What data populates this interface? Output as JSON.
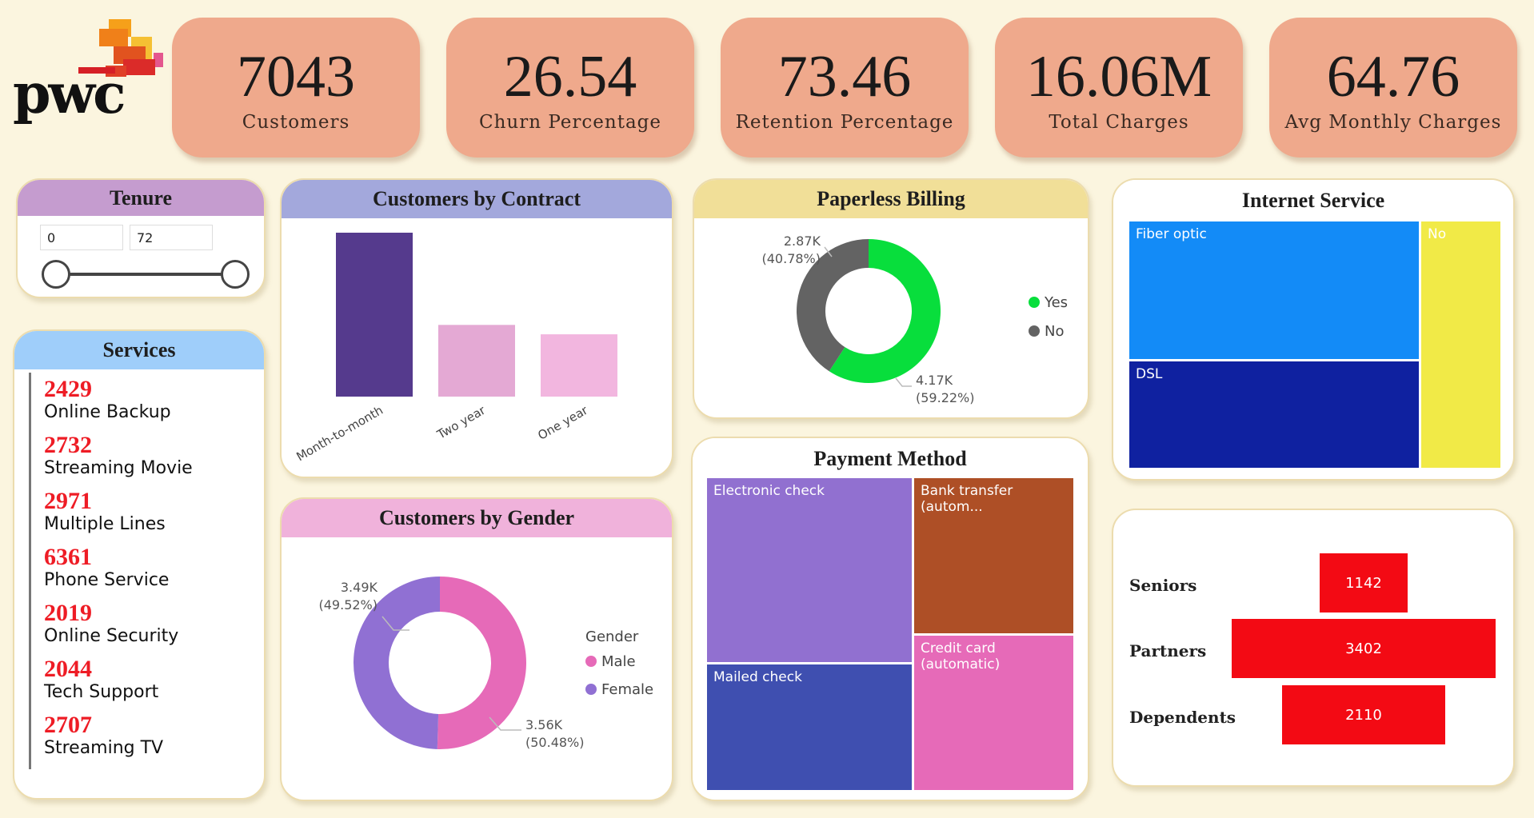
{
  "kpis": [
    {
      "value": "7043",
      "label": "Customers"
    },
    {
      "value": "26.54",
      "label": "Churn Percentage"
    },
    {
      "value": "73.46",
      "label": "Retention Percentage"
    },
    {
      "value": "16.06M",
      "label": "Total Charges"
    },
    {
      "value": "64.76",
      "label": "Avg Monthly Charges"
    }
  ],
  "logo": {
    "text": "pwc"
  },
  "tenure": {
    "title": "Tenure",
    "min": "0",
    "max": "72"
  },
  "services": {
    "title": "Services",
    "items": [
      {
        "count": "2429",
        "label": "Online Backup"
      },
      {
        "count": "2732",
        "label": "Streaming Movie"
      },
      {
        "count": "2971",
        "label": "Multiple Lines"
      },
      {
        "count": "6361",
        "label": "Phone Service"
      },
      {
        "count": "2019",
        "label": "Online Security"
      },
      {
        "count": "2044",
        "label": "Tech Support"
      },
      {
        "count": "2707",
        "label": "Streaming TV"
      }
    ]
  },
  "contract": {
    "title": "Customers by Contract"
  },
  "gender": {
    "title": "Customers by Gender",
    "legend_title": "Gender",
    "male_label": "3.56K",
    "male_pct": "(50.48%)",
    "female_label": "3.49K",
    "female_pct": "(49.52%)"
  },
  "paperless": {
    "title": "Paperless Billing",
    "yes_label": "4.17K",
    "yes_pct": "(59.22%)",
    "no_label": "2.87K",
    "no_pct": "(40.78%)"
  },
  "payment": {
    "title": "Payment Method",
    "cells": [
      "Electronic check",
      "Bank transfer (autom...",
      "Mailed check",
      "Credit card (automatic)"
    ]
  },
  "internet": {
    "title": "Internet Service",
    "cells": [
      "Fiber optic",
      "DSL",
      "No"
    ]
  },
  "demographics": {
    "rows": [
      {
        "label": "Seniors",
        "value": "1142"
      },
      {
        "label": "Partners",
        "value": "3402"
      },
      {
        "label": "Dependents",
        "value": "2110"
      }
    ]
  },
  "colors": {
    "kpi_bg": "#efa98c",
    "accent_red": "#ee1c25",
    "page_bg": "#fbf5df"
  },
  "chart_data": [
    {
      "type": "bar",
      "title": "Customers by Contract",
      "categories": [
        "Month-to-month",
        "Two year",
        "One year"
      ],
      "values": [
        3875,
        1695,
        1473
      ],
      "colors": [
        "#553a8d",
        "#e4a9d4",
        "#f2b6df"
      ]
    },
    {
      "type": "pie",
      "title": "Customers by Gender",
      "categories": [
        "Male",
        "Female"
      ],
      "values": [
        3555,
        3488
      ],
      "colors": [
        "#e66ab8",
        "#9070d3"
      ],
      "legend": "right"
    },
    {
      "type": "pie",
      "title": "Paperless Billing",
      "categories": [
        "Yes",
        "No"
      ],
      "values": [
        4171,
        2872
      ],
      "colors": [
        "#08de3c",
        "#636363"
      ],
      "legend": "right"
    },
    {
      "type": "bar",
      "title": "",
      "orientation": "horizontal",
      "categories": [
        "Seniors",
        "Partners",
        "Dependents"
      ],
      "values": [
        1142,
        3402,
        2110
      ]
    }
  ]
}
